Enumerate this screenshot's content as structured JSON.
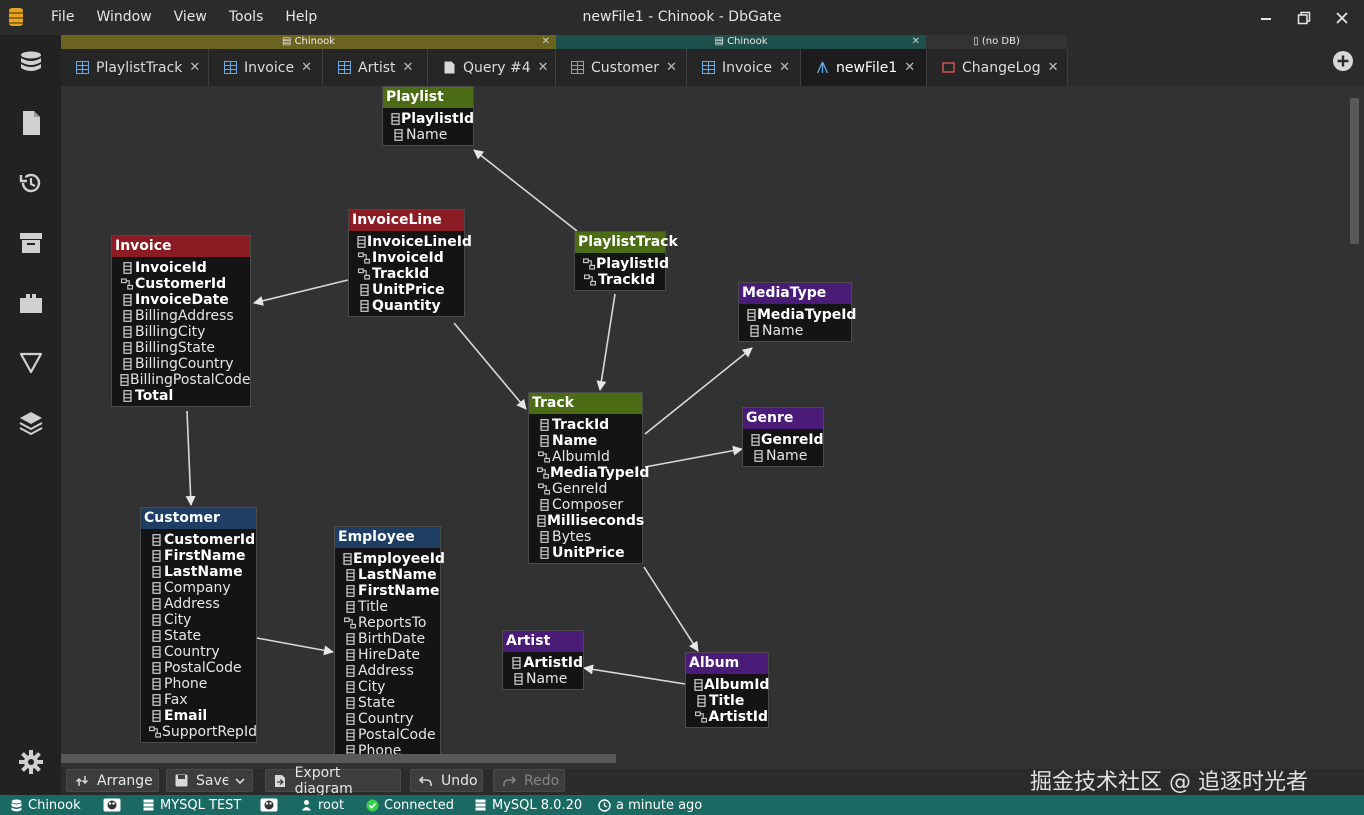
{
  "window": {
    "title": "newFile1 - Chinook - DbGate",
    "menu": [
      "File",
      "Window",
      "View",
      "Tools",
      "Help"
    ]
  },
  "groups": [
    {
      "label": "Chinook",
      "color": "#6a6420"
    },
    {
      "label": "Chinook",
      "color": "#1d4f4b"
    },
    {
      "label": "(no DB)",
      "color": "#333333"
    }
  ],
  "tabs": [
    {
      "label": "PlaylistTrack",
      "icon": "table-icon"
    },
    {
      "label": "Invoice",
      "icon": "table-icon"
    },
    {
      "label": "Artist",
      "icon": "table-icon"
    },
    {
      "label": "Query #4",
      "icon": "file-icon"
    },
    {
      "label": "Customer",
      "icon": "table-icon"
    },
    {
      "label": "Invoice",
      "icon": "table-icon"
    },
    {
      "label": "newFile1",
      "icon": "diagram-icon",
      "active": true
    },
    {
      "label": "ChangeLog",
      "icon": "changelog-icon"
    }
  ],
  "diagram": {
    "tables": [
      {
        "name": "Playlist",
        "color": "green",
        "columns": [
          {
            "name": "PlaylistId",
            "bold": true,
            "kind": "col"
          },
          {
            "name": "Name",
            "bold": false,
            "kind": "col"
          }
        ]
      },
      {
        "name": "InvoiceLine",
        "color": "red",
        "columns": [
          {
            "name": "InvoiceLineId",
            "bold": true,
            "kind": "col"
          },
          {
            "name": "InvoiceId",
            "bold": true,
            "kind": "fk"
          },
          {
            "name": "TrackId",
            "bold": true,
            "kind": "fk"
          },
          {
            "name": "UnitPrice",
            "bold": true,
            "kind": "col"
          },
          {
            "name": "Quantity",
            "bold": true,
            "kind": "col"
          }
        ]
      },
      {
        "name": "PlaylistTrack",
        "color": "green",
        "columns": [
          {
            "name": "PlaylistId",
            "bold": true,
            "kind": "fk"
          },
          {
            "name": "TrackId",
            "bold": true,
            "kind": "fk"
          }
        ]
      },
      {
        "name": "Invoice",
        "color": "red",
        "columns": [
          {
            "name": "InvoiceId",
            "bold": true,
            "kind": "col"
          },
          {
            "name": "CustomerId",
            "bold": true,
            "kind": "fk"
          },
          {
            "name": "InvoiceDate",
            "bold": true,
            "kind": "col"
          },
          {
            "name": "BillingAddress",
            "bold": false,
            "kind": "col"
          },
          {
            "name": "BillingCity",
            "bold": false,
            "kind": "col"
          },
          {
            "name": "BillingState",
            "bold": false,
            "kind": "col"
          },
          {
            "name": "BillingCountry",
            "bold": false,
            "kind": "col"
          },
          {
            "name": "BillingPostalCode",
            "bold": false,
            "kind": "col"
          },
          {
            "name": "Total",
            "bold": true,
            "kind": "col"
          }
        ]
      },
      {
        "name": "MediaType",
        "color": "purple",
        "columns": [
          {
            "name": "MediaTypeId",
            "bold": true,
            "kind": "col"
          },
          {
            "name": "Name",
            "bold": false,
            "kind": "col"
          }
        ]
      },
      {
        "name": "Genre",
        "color": "purple",
        "columns": [
          {
            "name": "GenreId",
            "bold": true,
            "kind": "col"
          },
          {
            "name": "Name",
            "bold": false,
            "kind": "col"
          }
        ]
      },
      {
        "name": "Track",
        "color": "green",
        "columns": [
          {
            "name": "TrackId",
            "bold": true,
            "kind": "col"
          },
          {
            "name": "Name",
            "bold": true,
            "kind": "col"
          },
          {
            "name": "AlbumId",
            "bold": false,
            "kind": "fk"
          },
          {
            "name": "MediaTypeId",
            "bold": true,
            "kind": "fk"
          },
          {
            "name": "GenreId",
            "bold": false,
            "kind": "fk"
          },
          {
            "name": "Composer",
            "bold": false,
            "kind": "col"
          },
          {
            "name": "Milliseconds",
            "bold": true,
            "kind": "col"
          },
          {
            "name": "Bytes",
            "bold": false,
            "kind": "col"
          },
          {
            "name": "UnitPrice",
            "bold": true,
            "kind": "col"
          }
        ]
      },
      {
        "name": "Customer",
        "color": "blue",
        "columns": [
          {
            "name": "CustomerId",
            "bold": true,
            "kind": "col"
          },
          {
            "name": "FirstName",
            "bold": true,
            "kind": "col"
          },
          {
            "name": "LastName",
            "bold": true,
            "kind": "col"
          },
          {
            "name": "Company",
            "bold": false,
            "kind": "col"
          },
          {
            "name": "Address",
            "bold": false,
            "kind": "col"
          },
          {
            "name": "City",
            "bold": false,
            "kind": "col"
          },
          {
            "name": "State",
            "bold": false,
            "kind": "col"
          },
          {
            "name": "Country",
            "bold": false,
            "kind": "col"
          },
          {
            "name": "PostalCode",
            "bold": false,
            "kind": "col"
          },
          {
            "name": "Phone",
            "bold": false,
            "kind": "col"
          },
          {
            "name": "Fax",
            "bold": false,
            "kind": "col"
          },
          {
            "name": "Email",
            "bold": true,
            "kind": "col"
          },
          {
            "name": "SupportRepId",
            "bold": false,
            "kind": "fk"
          }
        ]
      },
      {
        "name": "Employee",
        "color": "blue",
        "columns": [
          {
            "name": "EmployeeId",
            "bold": true,
            "kind": "col"
          },
          {
            "name": "LastName",
            "bold": true,
            "kind": "col"
          },
          {
            "name": "FirstName",
            "bold": true,
            "kind": "col"
          },
          {
            "name": "Title",
            "bold": false,
            "kind": "col"
          },
          {
            "name": "ReportsTo",
            "bold": false,
            "kind": "fk"
          },
          {
            "name": "BirthDate",
            "bold": false,
            "kind": "col"
          },
          {
            "name": "HireDate",
            "bold": false,
            "kind": "col"
          },
          {
            "name": "Address",
            "bold": false,
            "kind": "col"
          },
          {
            "name": "City",
            "bold": false,
            "kind": "col"
          },
          {
            "name": "State",
            "bold": false,
            "kind": "col"
          },
          {
            "name": "Country",
            "bold": false,
            "kind": "col"
          },
          {
            "name": "PostalCode",
            "bold": false,
            "kind": "col"
          },
          {
            "name": "Phone",
            "bold": false,
            "kind": "col"
          }
        ]
      },
      {
        "name": "Artist",
        "color": "purple",
        "columns": [
          {
            "name": "ArtistId",
            "bold": true,
            "kind": "col"
          },
          {
            "name": "Name",
            "bold": false,
            "kind": "col"
          }
        ]
      },
      {
        "name": "Album",
        "color": "purple",
        "columns": [
          {
            "name": "AlbumId",
            "bold": true,
            "kind": "col"
          },
          {
            "name": "Title",
            "bold": true,
            "kind": "col"
          },
          {
            "name": "ArtistId",
            "bold": true,
            "kind": "fk"
          }
        ]
      }
    ]
  },
  "toolbar": {
    "arrange": "Arrange",
    "save": "Save",
    "export": "Export diagram",
    "undo": "Undo",
    "redo": "Redo"
  },
  "watermark": "掘金技术社区 @ 追逐时光者",
  "status": {
    "db": "Chinook",
    "server": "MYSQL TEST",
    "user": "root",
    "connection": "Connected",
    "version": "MySQL 8.0.20",
    "time": "a minute ago"
  },
  "colors": {
    "status_bar": "#1a6a63",
    "header_green": "#4c6b15",
    "header_red": "#8b1c24",
    "header_purple": "#4a1c78",
    "header_blue": "#1e3f63",
    "connected": "#3ccf4e"
  }
}
